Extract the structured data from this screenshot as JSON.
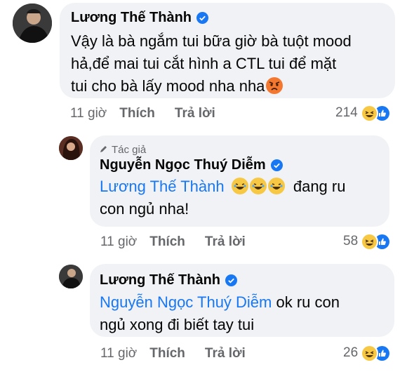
{
  "colors": {
    "accent": "#1877f2",
    "bubble": "#f0f2f5",
    "muted": "#65676b"
  },
  "comments": [
    {
      "author": "Lương Thế Thành",
      "text_lines": [
        "Vậy là bà ngắm tui bữa giờ bà tuột mood",
        "hả,để mai tui cắt hình a CTL tui để mặt",
        "tui cho bà lấy mood nha nha"
      ],
      "emoji": "angry-face",
      "time": "11 giờ",
      "like_label": "Thích",
      "reply_label": "Trả lời",
      "reaction_count": "214"
    },
    {
      "author_tag": "Tác giả",
      "author": "Nguyễn Ngọc Thuý Diễm",
      "mention": "Lương Thế Thành",
      "text_after_emoji": "đang ru",
      "text_line2": "con ngủ nha!",
      "emoji": "rolling-laughing-face",
      "time": "11 giờ",
      "like_label": "Thích",
      "reply_label": "Trả lời",
      "reaction_count": "58"
    },
    {
      "author": "Lương Thế Thành",
      "mention": "Nguyễn Ngọc Thuý Diễm",
      "text_after_mention": " ok ru con",
      "text_line2": "ngủ xong đi biết tay tui",
      "time": "11 giờ",
      "like_label": "Thích",
      "reply_label": "Trả lời",
      "reaction_count": "26"
    }
  ]
}
